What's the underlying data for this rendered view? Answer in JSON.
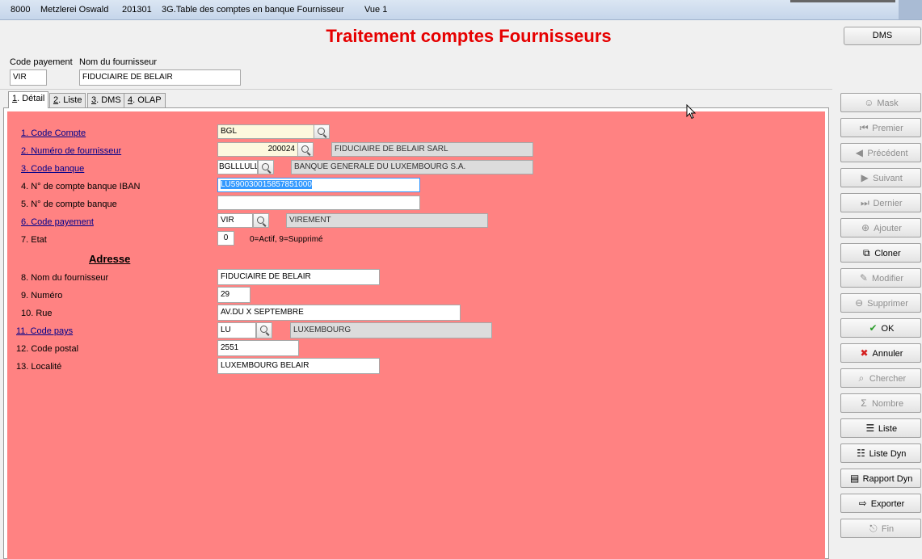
{
  "titlebar": {
    "company_code": "8000",
    "company_name": "Metzlerei Oswald",
    "period": "201301",
    "table": "3G.Table des comptes en banque Fournisseur",
    "view": "Vue 1"
  },
  "heading": "Traitement comptes Fournisseurs",
  "dms_button": "DMS",
  "header": {
    "code_payement_label": "Code payement",
    "code_payement_value": "VIR",
    "nom_fournisseur_label": "Nom du fournisseur",
    "nom_fournisseur_value": "FIDUCIAIRE DE BELAIR"
  },
  "tabs": [
    {
      "num": "1",
      "label": ". Détail"
    },
    {
      "num": "2",
      "label": ". Liste"
    },
    {
      "num": "3",
      "label": ". DMS"
    },
    {
      "num": "4",
      "label": ". OLAP"
    }
  ],
  "form": {
    "code_compte": {
      "label": "1. Code Compte",
      "value": "BGL"
    },
    "numero_fournisseur": {
      "label": "2. Numéro de fournisseur",
      "value": "200024",
      "desc": "FIDUCIAIRE DE BELAIR SARL"
    },
    "code_banque": {
      "label": "3. Code banque",
      "value": "BGLLLULL",
      "desc": "BANQUE GENERALE DU LUXEMBOURG S.A."
    },
    "iban": {
      "label": "4. N° de compte banque IBAN",
      "value": "LU590030015857851000"
    },
    "compte_banque": {
      "label": "5. N° de compte banque",
      "value": ""
    },
    "code_payement": {
      "label": "6. Code payement",
      "value": "VIR",
      "desc": "VIREMENT"
    },
    "etat": {
      "label": "7. Etat",
      "value": "0",
      "hint": "0=Actif, 9=Supprimé"
    },
    "adresse_title": "Adresse",
    "nom_fournisseur": {
      "label": "8. Nom du fournisseur",
      "value": "FIDUCIAIRE DE BELAIR"
    },
    "numero": {
      "label": "9. Numéro",
      "value": "29"
    },
    "rue": {
      "label": "10. Rue",
      "value": "AV.DU X SEPTEMBRE"
    },
    "code_pays": {
      "label": "11. Code pays",
      "value": "LU",
      "desc": "LUXEMBOURG"
    },
    "code_postal": {
      "label": "12. Code postal",
      "value": "2551"
    },
    "localite": {
      "label": "13. Localité",
      "value": "LUXEMBOURG BELAIR"
    }
  },
  "sidebar": [
    {
      "label": "Mask",
      "icon": "mask-icon",
      "glyph": "☺",
      "enabled": false
    },
    {
      "label": "Premier",
      "icon": "first-icon",
      "glyph": "⏮",
      "enabled": false
    },
    {
      "label": "Précédent",
      "icon": "previous-icon",
      "glyph": "◀",
      "enabled": false
    },
    {
      "label": "Suivant",
      "icon": "next-icon",
      "glyph": "▶",
      "enabled": false
    },
    {
      "label": "Dernier",
      "icon": "last-icon",
      "glyph": "⏭",
      "enabled": false
    },
    {
      "label": "Ajouter",
      "icon": "add-icon",
      "glyph": "⊕",
      "enabled": false
    },
    {
      "label": "Cloner",
      "icon": "clone-icon",
      "glyph": "⧉",
      "enabled": true
    },
    {
      "label": "Modifier",
      "icon": "edit-icon",
      "glyph": "✎",
      "enabled": false
    },
    {
      "label": "Supprimer",
      "icon": "delete-icon",
      "glyph": "⊖",
      "enabled": false
    },
    {
      "label": "OK",
      "icon": "check-icon",
      "glyph": "✔",
      "enabled": true
    },
    {
      "label": "Annuler",
      "icon": "cancel-icon",
      "glyph": "✖",
      "enabled": true
    },
    {
      "label": "Chercher",
      "icon": "search-icon",
      "glyph": "⌕",
      "enabled": false
    },
    {
      "label": "Nombre",
      "icon": "sigma-icon",
      "glyph": "Σ",
      "enabled": false
    },
    {
      "label": "Liste",
      "icon": "list-icon",
      "glyph": "☰",
      "enabled": true
    },
    {
      "label": "Liste Dyn",
      "icon": "dynamic-list-icon",
      "glyph": "☷",
      "enabled": true
    },
    {
      "label": "Rapport Dyn",
      "icon": "report-icon",
      "glyph": "▤",
      "enabled": true
    },
    {
      "label": "Exporter",
      "icon": "export-icon",
      "glyph": "⇨",
      "enabled": true
    },
    {
      "label": "Fin",
      "icon": "exit-icon",
      "glyph": "⎋",
      "enabled": false
    }
  ]
}
